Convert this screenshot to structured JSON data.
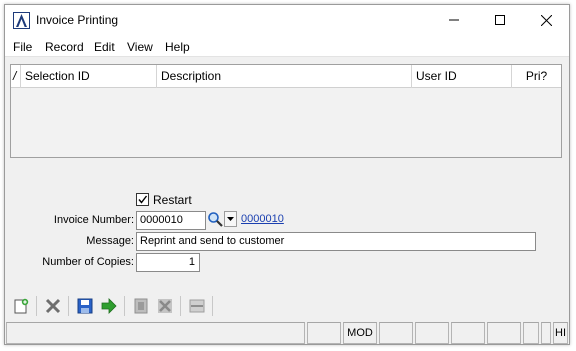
{
  "window": {
    "title": "Invoice Printing"
  },
  "menu": [
    "File",
    "Record",
    "Edit",
    "View",
    "Help"
  ],
  "grid": {
    "corner_mark": "/",
    "columns": [
      "Selection ID",
      "Description",
      "User ID",
      "Pri?"
    ],
    "rows": []
  },
  "form": {
    "restart": {
      "label": "Restart",
      "checked": true
    },
    "invoice_number": {
      "label": "Invoice Number:",
      "value": "0000010",
      "link": "0000010"
    },
    "message": {
      "label": "Message:",
      "value": "Reprint and send to customer"
    },
    "copies": {
      "label": "Number of Copies:",
      "value": "1"
    }
  },
  "toolbar": {
    "buttons": [
      "new-record",
      "delete",
      "save",
      "process",
      "print",
      "cancel",
      "minus"
    ]
  },
  "statusbar": {
    "cells": [
      "",
      "",
      "MOD",
      "",
      "",
      "",
      "",
      "",
      "",
      "HI"
    ]
  },
  "colors": {
    "accent_blue": "#1f5fbf",
    "link": "#1a3fb0",
    "process_green": "#2f9e2f"
  }
}
